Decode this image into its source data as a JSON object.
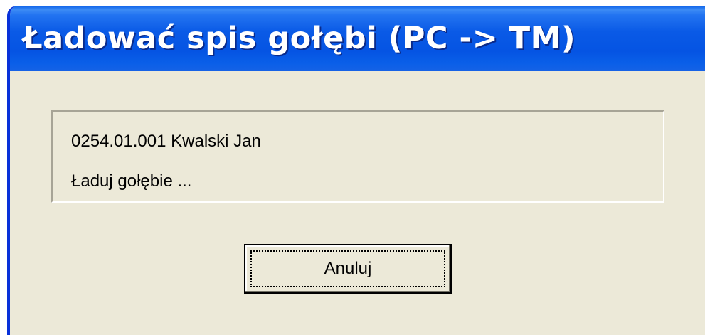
{
  "window": {
    "title": "Ładować spis gołębi (PC -> TM)"
  },
  "status": {
    "line1": "0254.01.001 Kwalski Jan",
    "line2": "Ładuj gołębie ..."
  },
  "buttons": {
    "cancel_label": "Anuluj"
  },
  "colors": {
    "titlebar": "#0554e3",
    "dialog_face": "#ece9d8",
    "title_text": "#ffffff"
  }
}
